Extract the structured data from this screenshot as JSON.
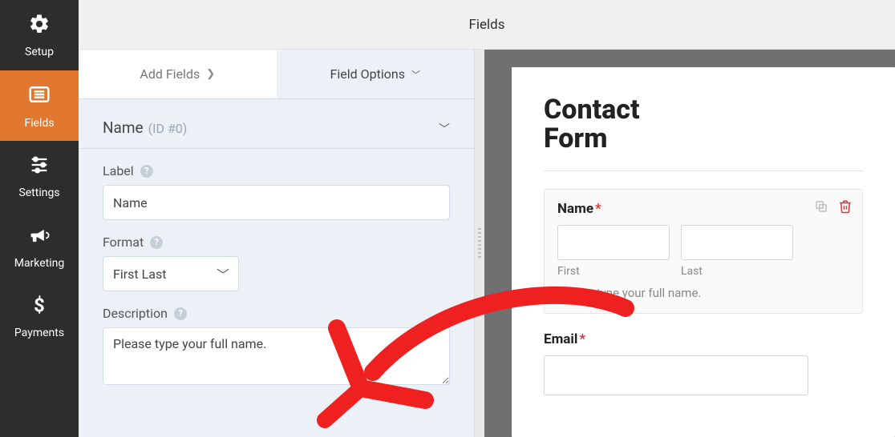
{
  "header": {
    "title": "Fields"
  },
  "sidebar": {
    "items": [
      {
        "label": "Setup"
      },
      {
        "label": "Fields"
      },
      {
        "label": "Settings"
      },
      {
        "label": "Marketing"
      },
      {
        "label": "Payments"
      }
    ]
  },
  "tabs": {
    "add_fields": "Add Fields",
    "field_options": "Field Options"
  },
  "section": {
    "name_label": "Name",
    "id_label": "(ID #0)"
  },
  "form": {
    "label_caption": "Label",
    "label_value": "Name",
    "format_caption": "Format",
    "format_value": "First Last",
    "description_caption": "Description",
    "description_value": "Please type your full name."
  },
  "preview": {
    "form_title": "Contact Form",
    "name_label": "Name",
    "first_caption": "First",
    "last_caption": "Last",
    "name_description": "Please type your full name.",
    "email_label": "Email",
    "required_mark": "*"
  },
  "icons": {
    "copy": "copy-icon",
    "trash": "trash-icon"
  }
}
